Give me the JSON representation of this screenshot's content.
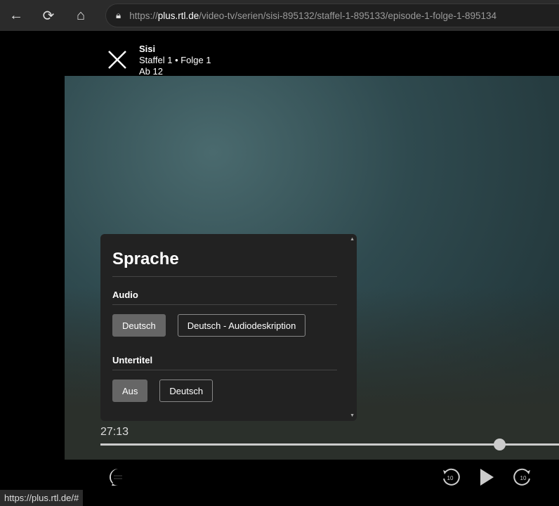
{
  "browser": {
    "url_prefix": "https://",
    "url_host": "plus.rtl.de",
    "url_path": "/video-tv/serien/sisi-895132/staffel-1-895133/episode-1-folge-1-895134",
    "status_url": "https://plus.rtl.de/#"
  },
  "show": {
    "title": "Sisi",
    "episode": "Staffel 1 • Folge 1",
    "rating": "Ab 12"
  },
  "panel": {
    "title": "Sprache",
    "audio_label": "Audio",
    "audio_options": [
      "Deutsch",
      "Deutsch - Audiodeskription"
    ],
    "audio_selected": "Deutsch",
    "subtitle_label": "Untertitel",
    "subtitle_options": [
      "Aus",
      "Deutsch"
    ],
    "subtitle_selected": "Aus"
  },
  "player": {
    "current_time": "27:13",
    "progress_fraction": 0.87,
    "rewind_seconds": "10",
    "forward_seconds": "10"
  }
}
